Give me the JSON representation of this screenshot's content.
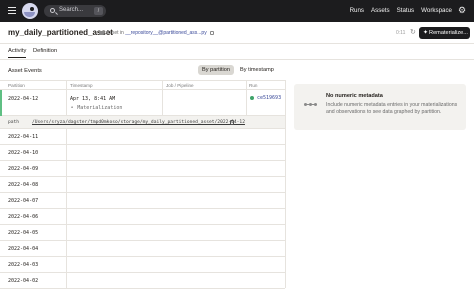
{
  "topbar": {
    "search_placeholder": "Search...",
    "search_shortcut": "/",
    "nav": [
      "Runs",
      "Assets",
      "Status",
      "Workspace"
    ]
  },
  "header": {
    "title": "my_daily_partitioned_asset",
    "asset_prefix": "Asset in",
    "repo_link": "__repository__@partitioned_ass...py",
    "counter": "0:11",
    "materialize_label": "Rematerialize..."
  },
  "tabs": [
    {
      "label": "Activity",
      "active": true
    },
    {
      "label": "Definition",
      "active": false
    }
  ],
  "events": {
    "heading": "Asset Events",
    "toggle": {
      "by_partition": "By partition",
      "by_timestamp": "By timestamp",
      "selected": "By partition"
    },
    "columns": [
      "Partition",
      "Timestamp",
      "Job / Pipeline",
      "Run"
    ],
    "selected": {
      "partition": "2022-04-12",
      "timestamp": "Apr 13, 8:41 AM",
      "kind": "Materialization",
      "run_id": "ce519693"
    },
    "path_key": "path",
    "path_value": "/Users/sryza/dagster/tmpd0mkoso/storage/my_daily_partitioned_asset/2022-04-12",
    "partitions": [
      "2022-04-11",
      "2022-04-10",
      "2022-04-09",
      "2022-04-08",
      "2022-04-07",
      "2022-04-06",
      "2022-04-05",
      "2022-04-04",
      "2022-04-03",
      "2022-04-02"
    ]
  },
  "metadata": {
    "title": "No numeric metadata",
    "description": "Include numeric metadata entries in your materializations and observations to see data graphed by partition."
  }
}
